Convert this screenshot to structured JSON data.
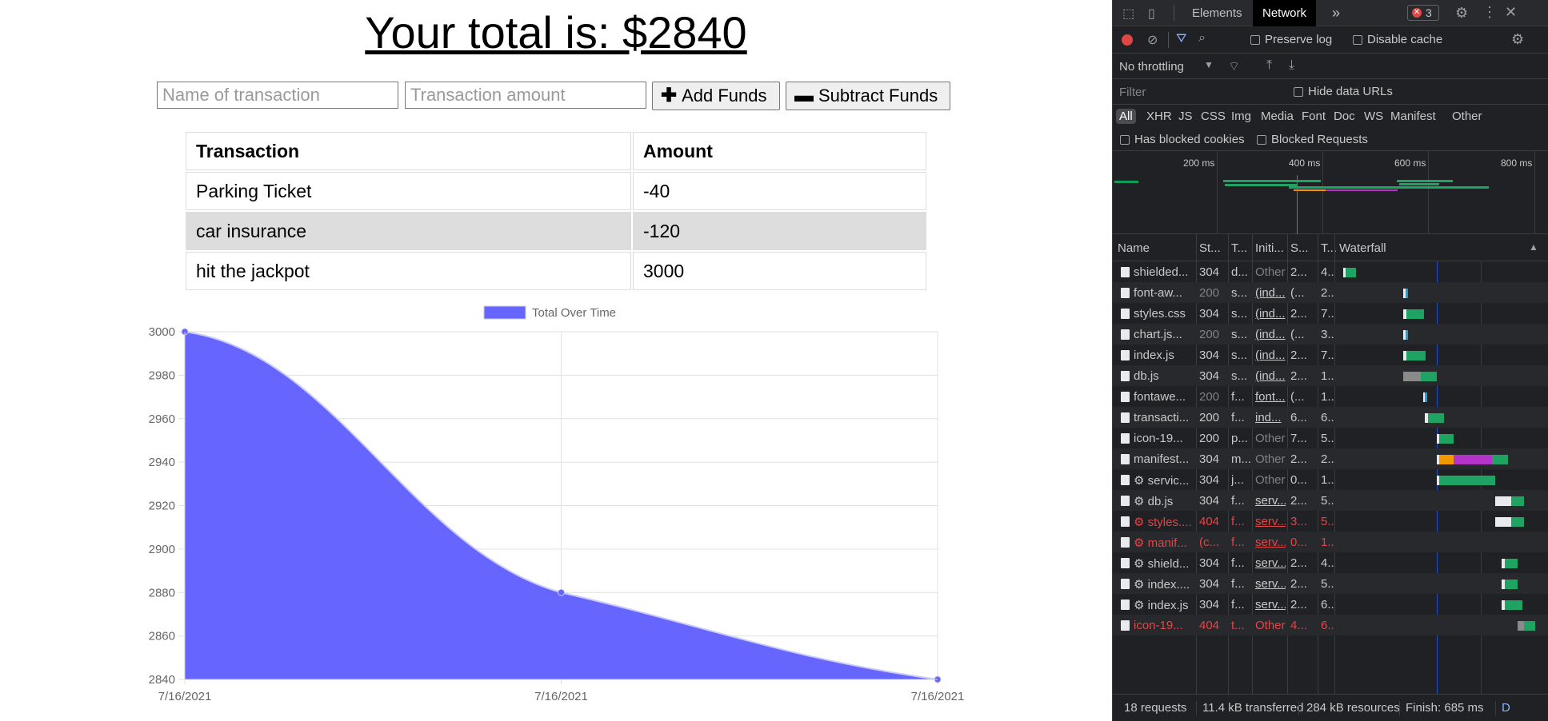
{
  "app": {
    "total_text": "Your total is: $2840",
    "name_placeholder": "Name of transaction",
    "amount_placeholder": "Transaction amount",
    "add_label": "Add Funds",
    "subtract_label": "Subtract Funds",
    "table": {
      "headers": [
        "Transaction",
        "Amount"
      ],
      "rows": [
        {
          "name": "Parking Ticket",
          "amount": "-40"
        },
        {
          "name": "car insurance",
          "amount": "-120"
        },
        {
          "name": "hit the jackpot",
          "amount": "3000"
        }
      ]
    }
  },
  "chart_data": {
    "type": "area",
    "x": [
      "7/16/2021",
      "7/16/2021",
      "7/16/2021"
    ],
    "series": [
      {
        "name": "Total Over Time",
        "values": [
          3000,
          2880,
          2840
        ],
        "color": "#6666ff"
      }
    ],
    "yticks": [
      3000,
      2980,
      2960,
      2940,
      2920,
      2900,
      2880,
      2860,
      2840
    ],
    "ylim": [
      2840,
      3000
    ],
    "legend": "top",
    "grid": true
  },
  "devtools": {
    "tabs": [
      "Elements",
      "Network"
    ],
    "active_tab": "Network",
    "more_tabs": "»",
    "error_count": "3",
    "preserve_log": "Preserve log",
    "disable_cache": "Disable cache",
    "throttling": "No throttling",
    "filter_placeholder": "Filter",
    "hide_data_urls": "Hide data URLs",
    "types": [
      "All",
      "XHR",
      "JS",
      "CSS",
      "Img",
      "Media",
      "Font",
      "Doc",
      "WS",
      "Manifest",
      "Other"
    ],
    "has_blocked_cookies": "Has blocked cookies",
    "blocked_requests": "Blocked Requests",
    "timeline_ticks": [
      "200 ms",
      "400 ms",
      "600 ms",
      "800 ms"
    ],
    "columns": [
      "Name",
      "St...",
      "T...",
      "Initi...",
      "S...",
      "T...",
      "Waterfall"
    ],
    "requests": [
      {
        "name": "shielded...",
        "status": "304",
        "type": "d...",
        "initiator": "Other",
        "size": "2...",
        "time": "4...",
        "err": false,
        "gear": false,
        "init_link": false,
        "dim_init": true
      },
      {
        "name": "font-aw...",
        "status": "200",
        "type": "s...",
        "initiator": "(ind...",
        "size": "(...",
        "time": "2...",
        "err": false,
        "gear": false,
        "init_link": true,
        "dim_status": true
      },
      {
        "name": "styles.css",
        "status": "304",
        "type": "s...",
        "initiator": "(ind...",
        "size": "2...",
        "time": "7...",
        "err": false,
        "gear": false,
        "init_link": true
      },
      {
        "name": "chart.js...",
        "status": "200",
        "type": "s...",
        "initiator": "(ind...",
        "size": "(...",
        "time": "3...",
        "err": false,
        "gear": false,
        "init_link": true,
        "dim_status": true
      },
      {
        "name": "index.js",
        "status": "304",
        "type": "s...",
        "initiator": "(ind...",
        "size": "2...",
        "time": "7...",
        "err": false,
        "gear": false,
        "init_link": true
      },
      {
        "name": "db.js",
        "status": "304",
        "type": "s...",
        "initiator": "(ind...",
        "size": "2...",
        "time": "1...",
        "err": false,
        "gear": false,
        "init_link": true
      },
      {
        "name": "fontawe...",
        "status": "200",
        "type": "f...",
        "initiator": "font...",
        "size": "(...",
        "time": "1...",
        "err": false,
        "gear": false,
        "init_link": true,
        "dim_status": true
      },
      {
        "name": "transacti...",
        "status": "200",
        "type": "f...",
        "initiator": "ind...",
        "size": "6...",
        "time": "6...",
        "err": false,
        "gear": false,
        "init_link": true
      },
      {
        "name": "icon-19...",
        "status": "200",
        "type": "p...",
        "initiator": "Other",
        "size": "7...",
        "time": "5...",
        "err": false,
        "gear": false,
        "init_link": false,
        "dim_init": true
      },
      {
        "name": "manifest...",
        "status": "304",
        "type": "m...",
        "initiator": "Other",
        "size": "2...",
        "time": "2...",
        "err": false,
        "gear": false,
        "init_link": false,
        "dim_init": true
      },
      {
        "name": "servic...",
        "status": "304",
        "type": "j...",
        "initiator": "Other",
        "size": "0...",
        "time": "1...",
        "err": false,
        "gear": true,
        "init_link": false,
        "dim_init": true
      },
      {
        "name": "db.js",
        "status": "304",
        "type": "f...",
        "initiator": "serv...",
        "size": "2...",
        "time": "5...",
        "err": false,
        "gear": true,
        "init_link": true
      },
      {
        "name": "styles....",
        "status": "404",
        "type": "f...",
        "initiator": "serv...",
        "size": "3...",
        "time": "5...",
        "err": true,
        "gear": true,
        "init_link": true
      },
      {
        "name": "manif...",
        "status": "(c...",
        "type": "f...",
        "initiator": "serv...",
        "size": "0...",
        "time": "1...",
        "err": true,
        "gear": true,
        "init_link": true
      },
      {
        "name": "shield...",
        "status": "304",
        "type": "f...",
        "initiator": "serv...",
        "size": "2...",
        "time": "4...",
        "err": false,
        "gear": true,
        "init_link": true
      },
      {
        "name": "index....",
        "status": "304",
        "type": "f...",
        "initiator": "serv...",
        "size": "2...",
        "time": "5...",
        "err": false,
        "gear": true,
        "init_link": true
      },
      {
        "name": "index.js",
        "status": "304",
        "type": "f...",
        "initiator": "serv...",
        "size": "2...",
        "time": "6...",
        "err": false,
        "gear": true,
        "init_link": true
      },
      {
        "name": "icon-19...",
        "status": "404",
        "type": "t...",
        "initiator": "Other",
        "size": "4...",
        "time": "6...",
        "err": true,
        "gear": false,
        "init_link": false
      }
    ],
    "status": {
      "requests": "18 requests",
      "transferred": "11.4 kB transferred",
      "resources": "284 kB resources",
      "finish": "Finish: 685 ms",
      "more": "D"
    }
  }
}
